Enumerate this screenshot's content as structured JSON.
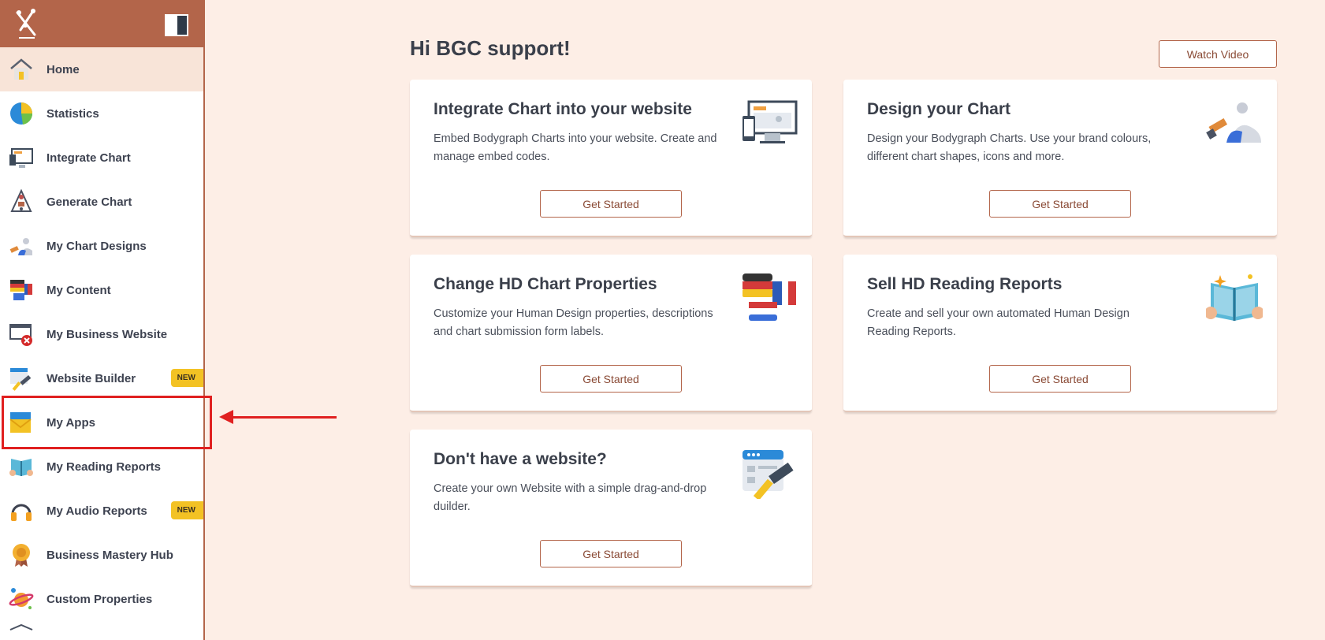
{
  "sidebar": {
    "items": [
      {
        "label": "Home",
        "icon": "home-icon",
        "active": true
      },
      {
        "label": "Statistics",
        "icon": "pie-chart-icon"
      },
      {
        "label": "Integrate Chart",
        "icon": "monitor-chart-icon"
      },
      {
        "label": "Generate Chart",
        "icon": "bodygraph-icon"
      },
      {
        "label": "My Chart Designs",
        "icon": "design-brush-icon"
      },
      {
        "label": "My Content",
        "icon": "flags-chat-icon"
      },
      {
        "label": "My Business Website",
        "icon": "website-error-icon"
      },
      {
        "label": "Website Builder",
        "icon": "builder-hammer-icon",
        "badge": "NEW"
      },
      {
        "label": "My Apps",
        "icon": "apps-envelope-icon"
      },
      {
        "label": "My Reading Reports",
        "icon": "book-icon"
      },
      {
        "label": "My Audio Reports",
        "icon": "headphones-icon",
        "badge": "NEW"
      },
      {
        "label": "Business Mastery Hub",
        "icon": "medal-icon"
      },
      {
        "label": "Custom Properties",
        "icon": "planet-icon"
      }
    ]
  },
  "main": {
    "greeting": "Hi BGC support!",
    "watch_video": "Watch Video",
    "cards": [
      {
        "title": "Integrate Chart into your website",
        "desc": "Embed Bodygraph Charts into your website. Create and manage embed codes.",
        "button": "Get Started",
        "icon": "monitor-devices-icon"
      },
      {
        "title": "Design your Chart",
        "desc": "Design your Bodygraph Charts. Use your brand colours, different chart shapes, icons and more.",
        "button": "Get Started",
        "icon": "design-brush-icon"
      },
      {
        "title": "Change HD Chart Properties",
        "desc": "Customize your Human Design properties, descriptions and chart submission form labels.",
        "button": "Get Started",
        "icon": "flags-chat-icon"
      },
      {
        "title": "Sell HD Reading Reports",
        "desc": "Create and sell your own automated Human Design Reading Reports.",
        "button": "Get Started",
        "icon": "open-book-icon"
      },
      {
        "title": "Don't have a website?",
        "desc": "Create your own Website with a simple drag-and-drop duilder.",
        "button": "Get Started",
        "icon": "builder-hammer-icon"
      }
    ]
  },
  "colors": {
    "accent": "#b3654a",
    "background": "#fdeee6",
    "badge": "#f3c224",
    "highlight": "#e02020"
  }
}
